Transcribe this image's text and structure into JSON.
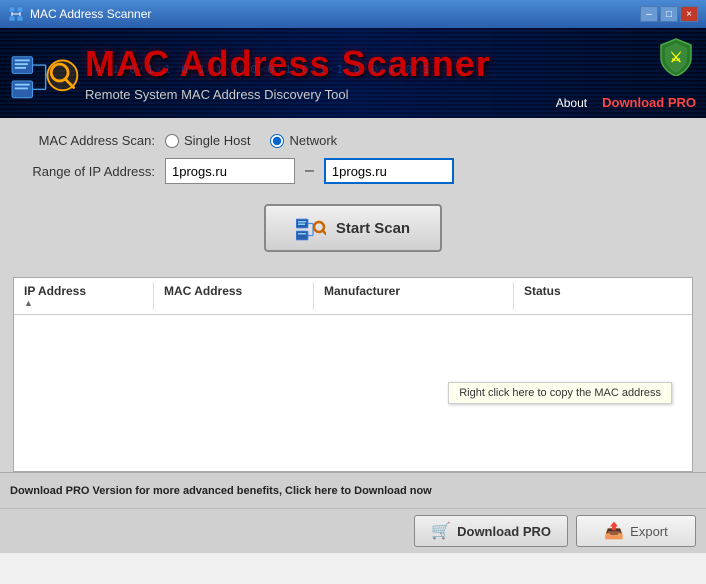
{
  "titlebar": {
    "title": "MAC Address Scanner",
    "minimize": "–",
    "maximize": "□",
    "close": "×"
  },
  "header": {
    "title": "MAC Address Scanner",
    "subtitle": "Remote System MAC Address Discovery Tool",
    "binary": "4·1·0·1·1  0·1·1·1·0·0·1·0·1·",
    "nav_about": "About",
    "nav_download": "Download PRO"
  },
  "form": {
    "mac_scan_label": "MAC Address Scan:",
    "ip_range_label": "Range of IP Address:",
    "single_host_label": "Single Host",
    "network_label": "Network",
    "ip_from": "1progs.ru",
    "ip_to": "1progs.ru",
    "scan_button": "Start Scan"
  },
  "table": {
    "columns": [
      "IP Address",
      "MAC Address",
      "Manufacturer",
      "Status"
    ],
    "context_hint": "Right click here to copy the MAC address"
  },
  "footer": {
    "promo": "Download PRO Version for more advanced benefits, Click here to Download now",
    "download_btn": "Download PRO",
    "export_btn": "Export"
  }
}
